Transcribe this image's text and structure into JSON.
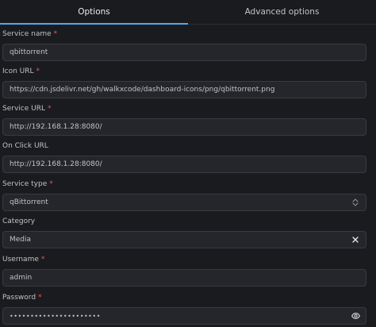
{
  "tabs": [
    {
      "label": "Options",
      "active": true
    },
    {
      "label": "Advanced options",
      "active": false
    }
  ],
  "fields": {
    "service_name": {
      "label": "Service name",
      "required": "*",
      "value": "qbittorrent"
    },
    "icon_url": {
      "label": "Icon URL",
      "required": "*",
      "value": "https://cdn.jsdelivr.net/gh/walkxcode/dashboard-icons/png/qbittorrent.png"
    },
    "service_url": {
      "label": "Service URL",
      "required": "*",
      "value": "http://192.168.1.28:8080/"
    },
    "on_click_url": {
      "label": "On Click URL",
      "value": "http://192.168.1.28:8080/"
    },
    "service_type": {
      "label": "Service type",
      "required": "*",
      "value": "qBittorrent",
      "icon": "chevron-updown-icon"
    },
    "category": {
      "label": "Category",
      "value": "Media",
      "icon": "clear-x-icon"
    },
    "username": {
      "label": "Username",
      "required": "*",
      "value": "admin"
    },
    "password": {
      "label": "Password",
      "required": "*",
      "value": "••••••••••••••••••••••",
      "icon": "eye-icon"
    }
  },
  "colors": {
    "background": "#1a1b1e",
    "input_background": "#25262b",
    "input_border": "#373a40",
    "accent": "#4dabf7",
    "required": "#fa5252"
  }
}
